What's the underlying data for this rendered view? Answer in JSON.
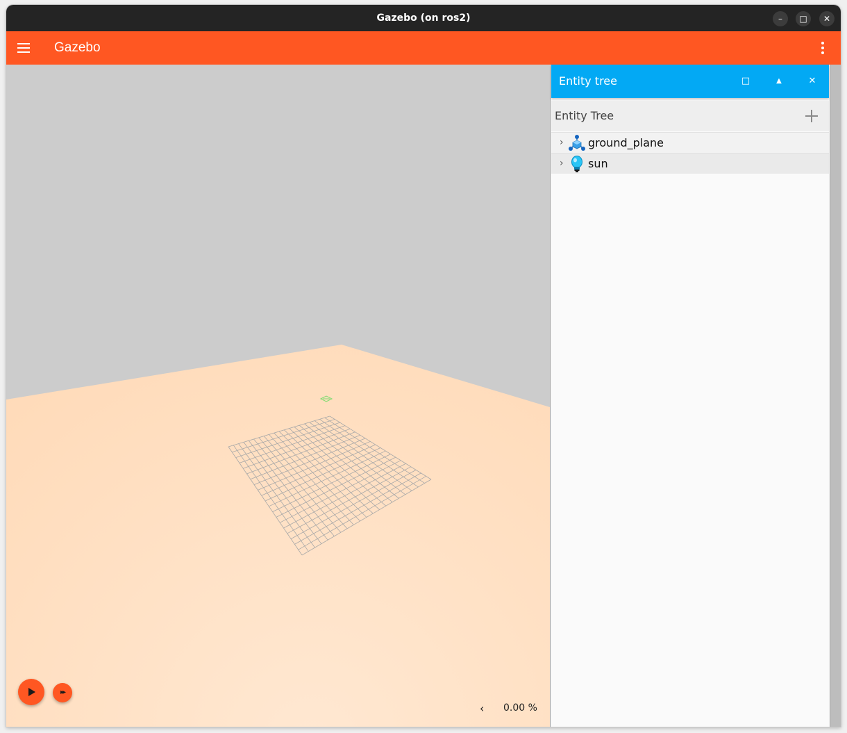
{
  "window": {
    "title": "Gazebo (on ros2)",
    "minimize_glyph": "–",
    "maximize_glyph": "□",
    "close_glyph": "✕"
  },
  "appbar": {
    "title": "Gazebo",
    "menu_icon": "hamburger-menu-icon",
    "overflow_icon": "more-vert-icon",
    "color": "#ff5722"
  },
  "viewport": {
    "sky_color": "#cccccc",
    "ground_color": "#ffdfc0",
    "play_icon": "play-icon",
    "step_icon": "fast-forward-icon",
    "step_glyph": "▸▸",
    "rtf_chevron": "‹",
    "rtf_value": "0.00 %"
  },
  "panel": {
    "title": "Entity tree",
    "header_color": "#03a9f4",
    "maximize_glyph": "□",
    "collapse_glyph": "▲",
    "close_glyph": "✕",
    "tree_label": "Entity Tree",
    "add_icon": "plus-icon",
    "entities": [
      {
        "name": "ground_plane",
        "icon": "model-icon",
        "expander": "›"
      },
      {
        "name": "sun",
        "icon": "light-bulb-icon",
        "expander": "›"
      }
    ]
  }
}
